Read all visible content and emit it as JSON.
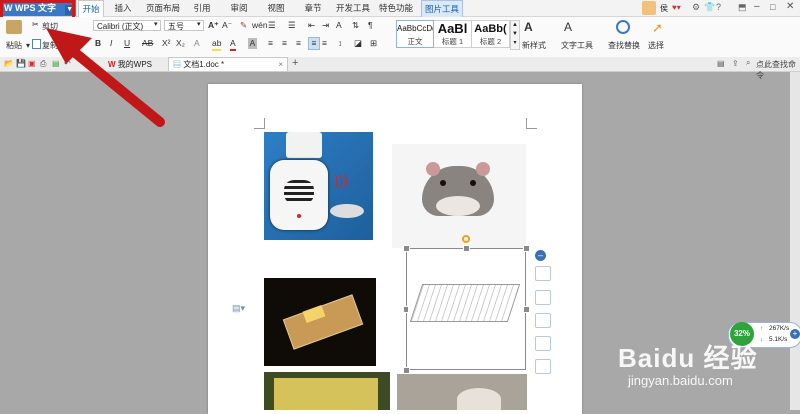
{
  "menubar": {
    "app_button": "WPS 文字",
    "tabs": [
      "开始",
      "插入",
      "页面布局",
      "引用",
      "审阅",
      "视图",
      "章节",
      "开发工具",
      "特色功能",
      "图片工具"
    ],
    "user": "侯"
  },
  "ribbon": {
    "cut": "剪切",
    "paste": "粘贴",
    "copy": "复制",
    "font_name": "Calibri (正文)",
    "font_size": "五号",
    "styles": [
      {
        "preview": "AaBbCcDd",
        "name": "正文"
      },
      {
        "preview": "AaBl",
        "name": "标题 1"
      },
      {
        "preview": "AaBb(",
        "name": "标题 2"
      }
    ],
    "new_style": "新样式",
    "text_tools": "文字工具",
    "find_replace": "查找替换",
    "select": "选择"
  },
  "tabbar": {
    "tabs": [
      {
        "label": "我的WPS"
      },
      {
        "label": "文档1.doc *"
      }
    ],
    "new_tab": "+",
    "search_placeholder": "点此查找命令"
  },
  "status_widget": {
    "percent": "32%",
    "up": "267K/s",
    "down": "5.1K/s"
  },
  "watermark": {
    "brand": "Baidu 经验",
    "url": "jingyan.baidu.com"
  },
  "colors": {
    "wps_blue": "#3b79c6",
    "arrow_red": "#c01818",
    "highlight_box": "#d01a1a"
  }
}
